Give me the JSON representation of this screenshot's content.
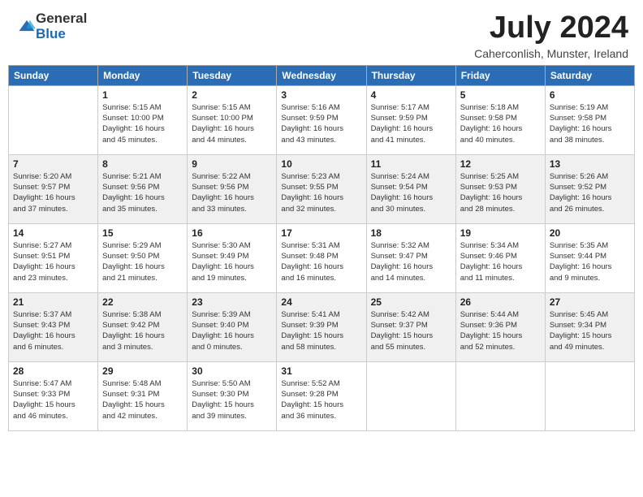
{
  "header": {
    "logo_general": "General",
    "logo_blue": "Blue",
    "month_title": "July 2024",
    "location": "Caherconlish, Munster, Ireland"
  },
  "days_of_week": [
    "Sunday",
    "Monday",
    "Tuesday",
    "Wednesday",
    "Thursday",
    "Friday",
    "Saturday"
  ],
  "weeks": [
    [
      {
        "day": "",
        "info": ""
      },
      {
        "day": "1",
        "info": "Sunrise: 5:15 AM\nSunset: 10:00 PM\nDaylight: 16 hours\nand 45 minutes."
      },
      {
        "day": "2",
        "info": "Sunrise: 5:15 AM\nSunset: 10:00 PM\nDaylight: 16 hours\nand 44 minutes."
      },
      {
        "day": "3",
        "info": "Sunrise: 5:16 AM\nSunset: 9:59 PM\nDaylight: 16 hours\nand 43 minutes."
      },
      {
        "day": "4",
        "info": "Sunrise: 5:17 AM\nSunset: 9:59 PM\nDaylight: 16 hours\nand 41 minutes."
      },
      {
        "day": "5",
        "info": "Sunrise: 5:18 AM\nSunset: 9:58 PM\nDaylight: 16 hours\nand 40 minutes."
      },
      {
        "day": "6",
        "info": "Sunrise: 5:19 AM\nSunset: 9:58 PM\nDaylight: 16 hours\nand 38 minutes."
      }
    ],
    [
      {
        "day": "7",
        "info": "Sunrise: 5:20 AM\nSunset: 9:57 PM\nDaylight: 16 hours\nand 37 minutes."
      },
      {
        "day": "8",
        "info": "Sunrise: 5:21 AM\nSunset: 9:56 PM\nDaylight: 16 hours\nand 35 minutes."
      },
      {
        "day": "9",
        "info": "Sunrise: 5:22 AM\nSunset: 9:56 PM\nDaylight: 16 hours\nand 33 minutes."
      },
      {
        "day": "10",
        "info": "Sunrise: 5:23 AM\nSunset: 9:55 PM\nDaylight: 16 hours\nand 32 minutes."
      },
      {
        "day": "11",
        "info": "Sunrise: 5:24 AM\nSunset: 9:54 PM\nDaylight: 16 hours\nand 30 minutes."
      },
      {
        "day": "12",
        "info": "Sunrise: 5:25 AM\nSunset: 9:53 PM\nDaylight: 16 hours\nand 28 minutes."
      },
      {
        "day": "13",
        "info": "Sunrise: 5:26 AM\nSunset: 9:52 PM\nDaylight: 16 hours\nand 26 minutes."
      }
    ],
    [
      {
        "day": "14",
        "info": "Sunrise: 5:27 AM\nSunset: 9:51 PM\nDaylight: 16 hours\nand 23 minutes."
      },
      {
        "day": "15",
        "info": "Sunrise: 5:29 AM\nSunset: 9:50 PM\nDaylight: 16 hours\nand 21 minutes."
      },
      {
        "day": "16",
        "info": "Sunrise: 5:30 AM\nSunset: 9:49 PM\nDaylight: 16 hours\nand 19 minutes."
      },
      {
        "day": "17",
        "info": "Sunrise: 5:31 AM\nSunset: 9:48 PM\nDaylight: 16 hours\nand 16 minutes."
      },
      {
        "day": "18",
        "info": "Sunrise: 5:32 AM\nSunset: 9:47 PM\nDaylight: 16 hours\nand 14 minutes."
      },
      {
        "day": "19",
        "info": "Sunrise: 5:34 AM\nSunset: 9:46 PM\nDaylight: 16 hours\nand 11 minutes."
      },
      {
        "day": "20",
        "info": "Sunrise: 5:35 AM\nSunset: 9:44 PM\nDaylight: 16 hours\nand 9 minutes."
      }
    ],
    [
      {
        "day": "21",
        "info": "Sunrise: 5:37 AM\nSunset: 9:43 PM\nDaylight: 16 hours\nand 6 minutes."
      },
      {
        "day": "22",
        "info": "Sunrise: 5:38 AM\nSunset: 9:42 PM\nDaylight: 16 hours\nand 3 minutes."
      },
      {
        "day": "23",
        "info": "Sunrise: 5:39 AM\nSunset: 9:40 PM\nDaylight: 16 hours\nand 0 minutes."
      },
      {
        "day": "24",
        "info": "Sunrise: 5:41 AM\nSunset: 9:39 PM\nDaylight: 15 hours\nand 58 minutes."
      },
      {
        "day": "25",
        "info": "Sunrise: 5:42 AM\nSunset: 9:37 PM\nDaylight: 15 hours\nand 55 minutes."
      },
      {
        "day": "26",
        "info": "Sunrise: 5:44 AM\nSunset: 9:36 PM\nDaylight: 15 hours\nand 52 minutes."
      },
      {
        "day": "27",
        "info": "Sunrise: 5:45 AM\nSunset: 9:34 PM\nDaylight: 15 hours\nand 49 minutes."
      }
    ],
    [
      {
        "day": "28",
        "info": "Sunrise: 5:47 AM\nSunset: 9:33 PM\nDaylight: 15 hours\nand 46 minutes."
      },
      {
        "day": "29",
        "info": "Sunrise: 5:48 AM\nSunset: 9:31 PM\nDaylight: 15 hours\nand 42 minutes."
      },
      {
        "day": "30",
        "info": "Sunrise: 5:50 AM\nSunset: 9:30 PM\nDaylight: 15 hours\nand 39 minutes."
      },
      {
        "day": "31",
        "info": "Sunrise: 5:52 AM\nSunset: 9:28 PM\nDaylight: 15 hours\nand 36 minutes."
      },
      {
        "day": "",
        "info": ""
      },
      {
        "day": "",
        "info": ""
      },
      {
        "day": "",
        "info": ""
      }
    ]
  ]
}
